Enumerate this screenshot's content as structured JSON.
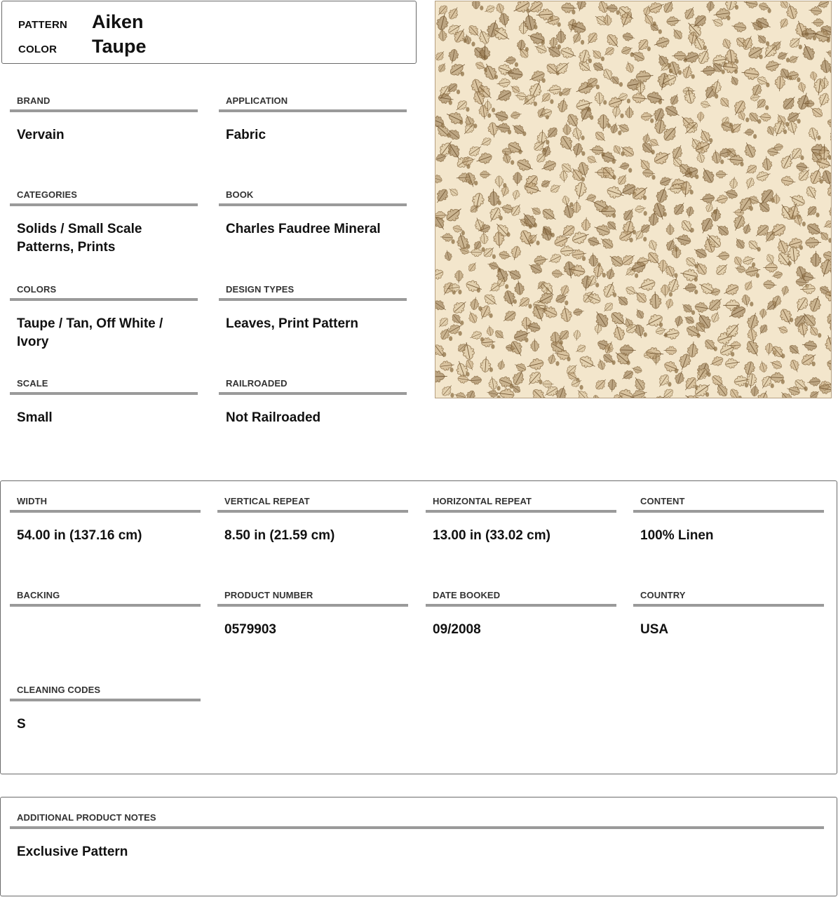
{
  "header": {
    "pattern_label": "PATTERN",
    "pattern_value": "Aiken",
    "color_label": "COLOR",
    "color_value": "Taupe"
  },
  "details": {
    "brand": {
      "label": "BRAND",
      "value": "Vervain"
    },
    "application": {
      "label": "APPLICATION",
      "value": "Fabric"
    },
    "categories": {
      "label": "CATEGORIES",
      "value": "Solids / Small Scale Patterns, Prints"
    },
    "book": {
      "label": "BOOK",
      "value": "Charles Faudree Mineral"
    },
    "colors": {
      "label": "COLORS",
      "value": "Taupe / Tan, Off White / Ivory"
    },
    "design_types": {
      "label": "DESIGN TYPES",
      "value": "Leaves, Print Pattern"
    },
    "scale": {
      "label": "SCALE",
      "value": "Small"
    },
    "railroaded": {
      "label": "RAILROADED",
      "value": "Not Railroaded"
    }
  },
  "specs": {
    "width": {
      "label": "WIDTH",
      "value": "54.00 in (137.16 cm)"
    },
    "vertical_repeat": {
      "label": "VERTICAL REPEAT",
      "value": "8.50 in (21.59 cm)"
    },
    "horizontal_repeat": {
      "label": "HORIZONTAL REPEAT",
      "value": "13.00 in (33.02 cm)"
    },
    "content": {
      "label": "CONTENT",
      "value": "100% Linen"
    },
    "backing": {
      "label": "BACKING",
      "value": ""
    },
    "product_number": {
      "label": "PRODUCT NUMBER",
      "value": "0579903"
    },
    "date_booked": {
      "label": "DATE BOOKED",
      "value": "09/2008"
    },
    "country": {
      "label": "COUNTRY",
      "value": "USA"
    },
    "cleaning_codes": {
      "label": "CLEANING CODES",
      "value": "S"
    }
  },
  "notes": {
    "label": "ADDITIONAL PRODUCT NOTES",
    "value": "Exclusive Pattern"
  },
  "swatch": {
    "background_color": "#f3e6cc",
    "leaf_colors": [
      "#a88a5e",
      "#c2a67a",
      "#8e7046",
      "#d6bf97"
    ]
  }
}
